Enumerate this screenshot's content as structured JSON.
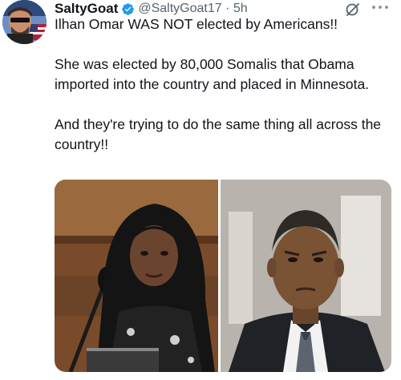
{
  "tweet": {
    "author_name": "SaltyGoat",
    "handle_time": "@SaltyGoat17 · 5h",
    "paragraphs": [
      "Ilhan Omar WAS NOT elected by Americans!!",
      "She was elected by 80,000 Somalis that Obama imported into the country and placed in Minnesota.",
      "And they're trying to do the same thing all across the country!!"
    ]
  },
  "icons": {
    "verified": "verified-badge-icon",
    "grok": "grok-icon",
    "more": "more-options-icon"
  },
  "colors": {
    "verified_blue": "#1d9bf0",
    "text_primary": "#0f1419",
    "text_secondary": "#536471"
  }
}
